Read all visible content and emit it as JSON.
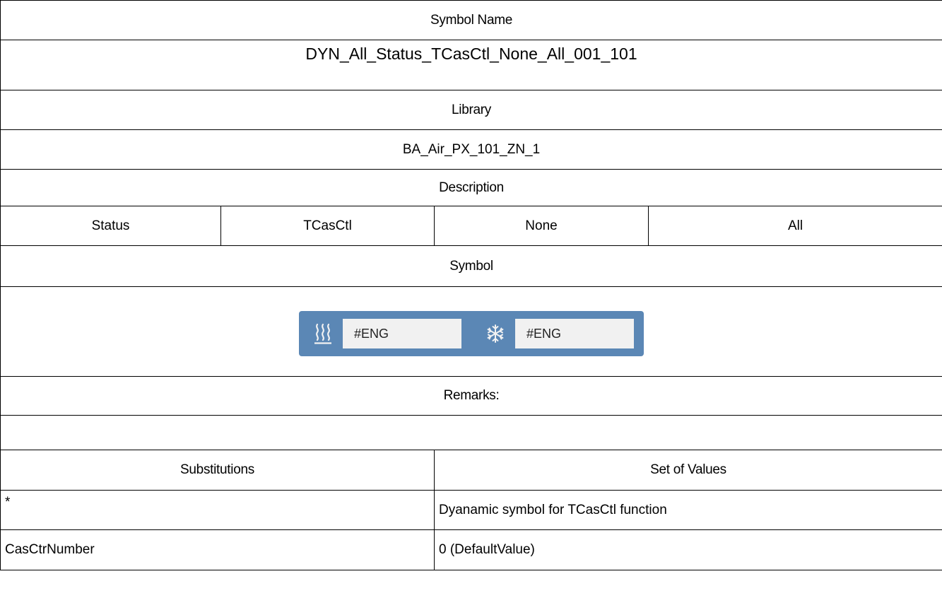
{
  "symbol_name": {
    "header": "Symbol Name",
    "value": "DYN_All_Status_TCasCtl_None_All_001_101"
  },
  "library": {
    "header": "Library",
    "value": "BA_Air_PX_101_ZN_1"
  },
  "description": {
    "header": "Description",
    "values": [
      "Status",
      "TCasCtl",
      "None",
      "All"
    ]
  },
  "symbol": {
    "header": "Symbol",
    "widget": {
      "background_color": "#5b87b5",
      "field_color": "#f1f1f1",
      "heat_icon": "heat-waves-icon",
      "cool_icon": "snowflake-icon",
      "heat_value": "#ENG",
      "cool_value": "#ENG"
    }
  },
  "remarks": {
    "header": "Remarks:",
    "value": ""
  },
  "substitutions": {
    "header_left": "Substitutions",
    "header_right": "Set of Values",
    "rows": [
      {
        "name": "*",
        "value": "Dyanamic symbol for TCasCtl function"
      },
      {
        "name": "CasCtrNumber",
        "value": "0 (DefaultValue)"
      }
    ]
  }
}
